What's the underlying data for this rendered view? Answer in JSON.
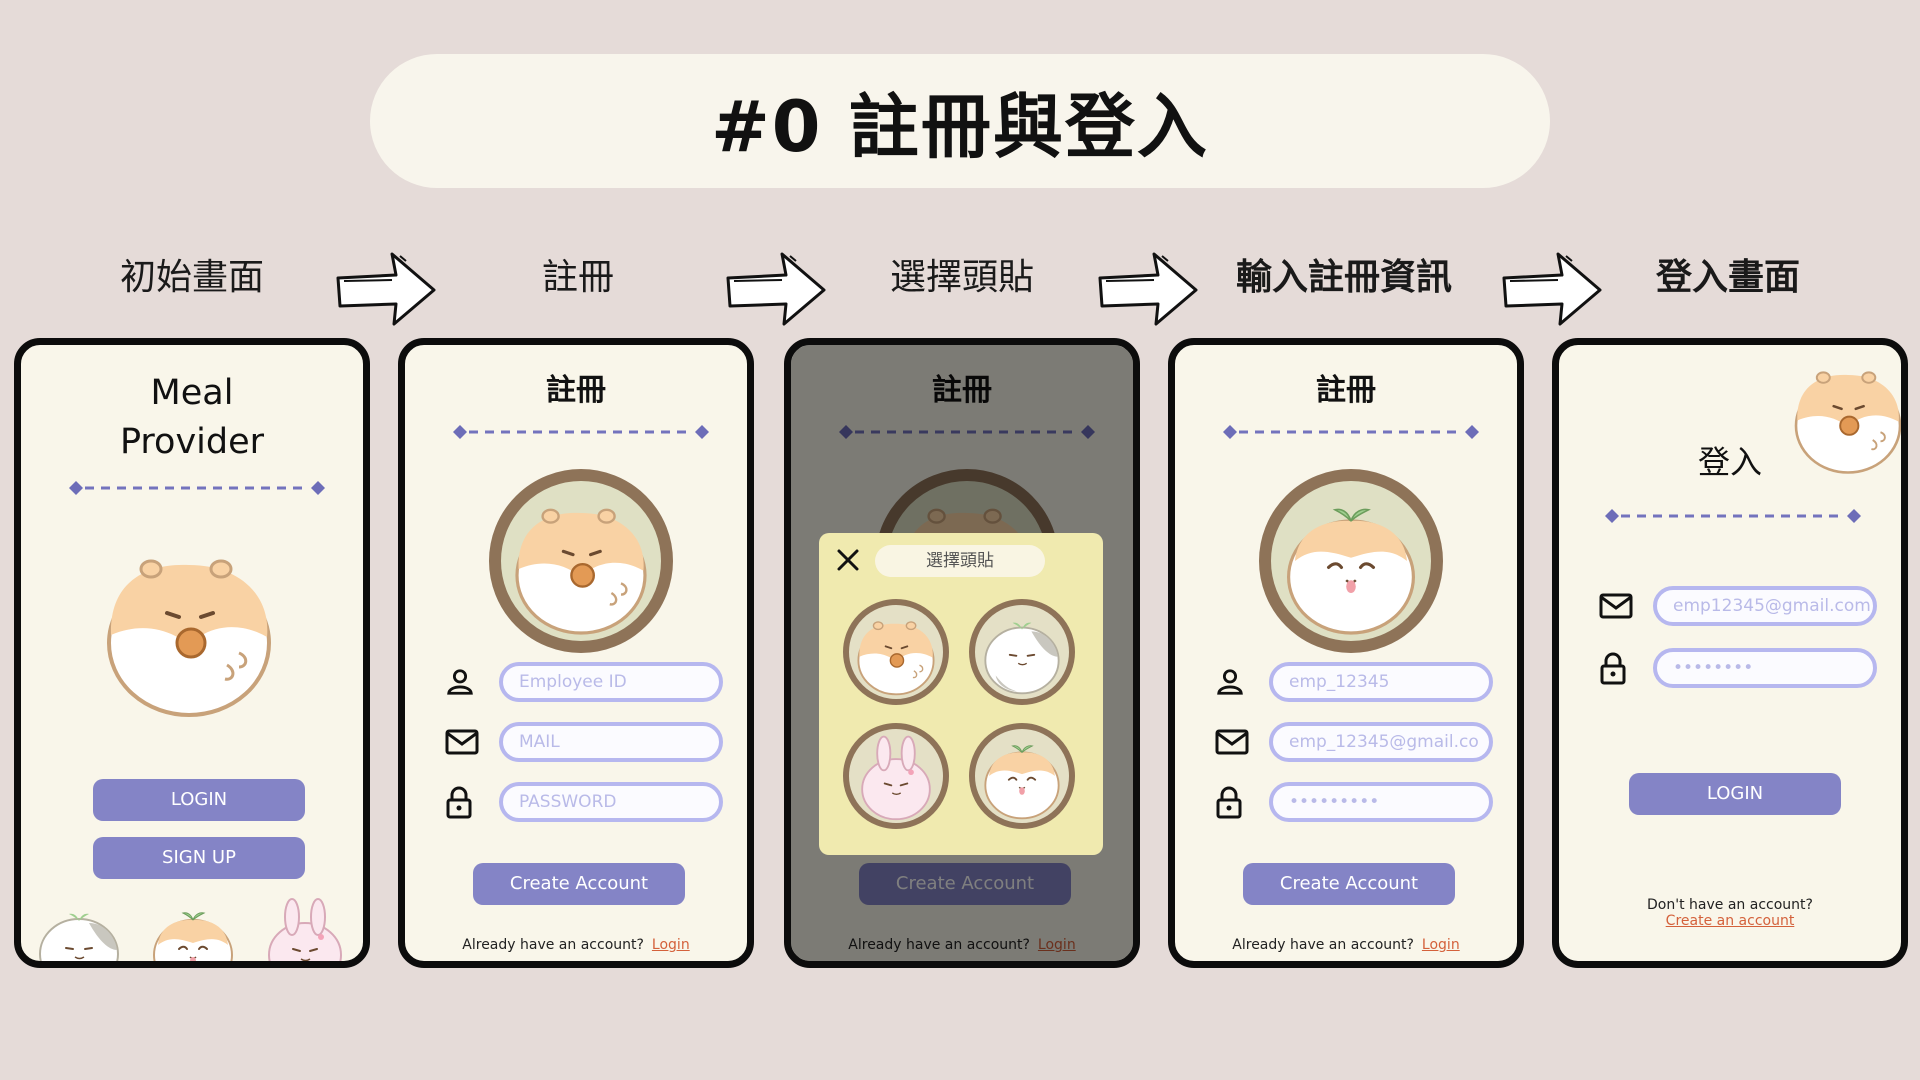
{
  "header": {
    "title": "#0 註冊與登入"
  },
  "steps": [
    {
      "label": "初始畫面"
    },
    {
      "label": "註冊"
    },
    {
      "label": "選擇頭貼"
    },
    {
      "label": "輸入註冊資訊"
    },
    {
      "label": "登入畫面"
    }
  ],
  "screen_initial": {
    "app_name_line1": "Meal",
    "app_name_line2": "Provider",
    "login_button": "LOGIN",
    "signup_button": "SIGN UP"
  },
  "screen_signup": {
    "title": "註冊",
    "employee_id_placeholder": "Employee ID",
    "mail_placeholder": "MAIL",
    "password_placeholder": "PASSWORD",
    "create_button": "Create Account",
    "footer_text": "Already have an account?",
    "footer_link": "Login"
  },
  "screen_avatar": {
    "title": "註冊",
    "modal_title": "選擇頭貼",
    "create_button": "Create Account",
    "footer_text": "Already have an account?",
    "footer_link": "Login"
  },
  "screen_filled": {
    "title": "註冊",
    "employee_id_value": "emp_12345",
    "mail_value": "emp_12345@gmail.co",
    "password_value": "•••••••••",
    "create_button": "Create Account",
    "footer_text": "Already have an account?",
    "footer_link": "Login"
  },
  "screen_login": {
    "title": "登入",
    "mail_value": "emp12345@gmail.com",
    "password_value": "••••••••",
    "login_button": "LOGIN",
    "footer_text": "Don't have an account?",
    "footer_link": "Create an account"
  },
  "colors": {
    "background": "#e5dbd8",
    "accent": "#8484c6",
    "field_border": "#b6b7ef",
    "link": "#d4613b",
    "avatar_ring": "#8e7358"
  }
}
